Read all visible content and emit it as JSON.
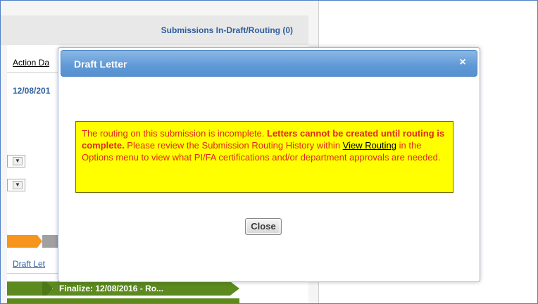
{
  "background": {
    "submissions_header": "Submissions In-Draft/Routing (0)",
    "action_date_header": "Action Da",
    "action_date_value": "12/08/201",
    "draft_letter_link": "Draft Let",
    "finalize_step": "Finalize: 12/08/2016 - Ro..."
  },
  "dialog": {
    "title": "Draft Letter",
    "close_icon": "×",
    "close_button_label": "Close",
    "message": {
      "part1": "The routing on this submission is incomplete. ",
      "bold": "Letters cannot be created until routing is complete.",
      "part2": " Please review the Submission Routing History within ",
      "link": "View Routing",
      "part3": " in the Options menu to view what PI/FA certifications and/or department approvals are needed."
    }
  },
  "icons": {
    "dropdown_arrow": "chevron-down-icon",
    "close": "close-icon"
  },
  "colors": {
    "accent_blue": "#2f5f9e",
    "titlebar": "#5f98d6",
    "warning_bg": "#ffff00",
    "warning_text": "#e0281e",
    "progress_orange": "#f7941d",
    "progress_green": "#5c8a1e"
  }
}
